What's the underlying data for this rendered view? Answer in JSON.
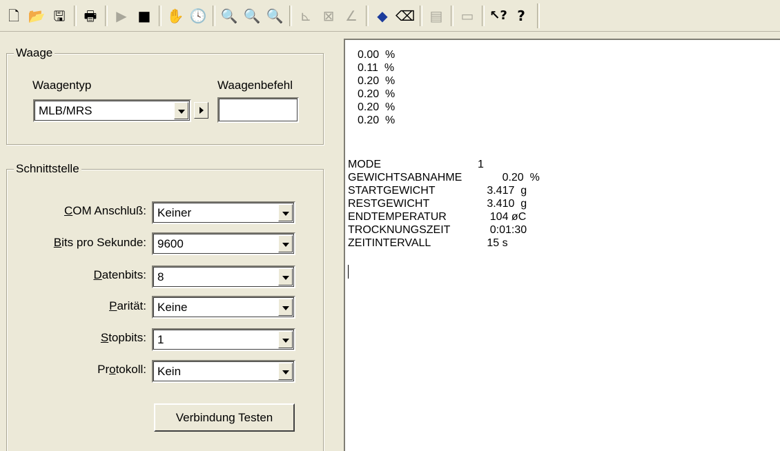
{
  "toolbar": {
    "buttons": [
      {
        "icon": "new-file-icon",
        "glyph": "🗋",
        "enabled": true
      },
      {
        "icon": "open-folder-icon",
        "glyph": "📂",
        "enabled": true
      },
      {
        "icon": "save-icon",
        "glyph": "🖫",
        "enabled": true
      },
      {
        "icon": "print-icon",
        "glyph": "🖶",
        "enabled": true
      },
      {
        "icon": "play-icon",
        "glyph": "▶",
        "enabled": false
      },
      {
        "icon": "stop-icon",
        "glyph": "■",
        "enabled": true
      },
      {
        "icon": "hand-icon",
        "glyph": "✋",
        "enabled": true
      },
      {
        "icon": "clock-icon",
        "glyph": "🕓",
        "enabled": true
      },
      {
        "icon": "zoom-in-icon",
        "glyph": "🔍",
        "enabled": false
      },
      {
        "icon": "zoom-out-icon",
        "glyph": "🔍",
        "enabled": false
      },
      {
        "icon": "zoom-fit-icon",
        "glyph": "🔍",
        "enabled": false
      },
      {
        "icon": "chart-line-icon",
        "glyph": "⊾",
        "enabled": false
      },
      {
        "icon": "chart-cross-icon",
        "glyph": "⊠",
        "enabled": false
      },
      {
        "icon": "chart-angle-icon",
        "glyph": "∠",
        "enabled": false
      },
      {
        "icon": "paint-bucket-icon",
        "glyph": "◆",
        "enabled": true
      },
      {
        "icon": "eraser-icon",
        "glyph": "⌫",
        "enabled": true
      },
      {
        "icon": "document-icon",
        "glyph": "▤",
        "enabled": false
      },
      {
        "icon": "window-icon",
        "glyph": "▭",
        "enabled": false
      },
      {
        "icon": "context-help-icon",
        "glyph": "↖?",
        "enabled": true
      },
      {
        "icon": "help-icon",
        "glyph": "?",
        "enabled": true
      }
    ]
  },
  "waage": {
    "title": "Waage",
    "waagentyp_label": "Waagentyp",
    "waagenbefehl_label": "Waagenbefehl",
    "waagentyp_value": "MLB/MRS",
    "waagenbefehl_value": ""
  },
  "schnittstelle": {
    "title": "Schnittstelle",
    "rows": [
      {
        "label_pre": "",
        "label_u": "C",
        "label_post": "OM Anschluß:",
        "value": "Keiner"
      },
      {
        "label_pre": "",
        "label_u": "B",
        "label_post": "its pro Sekunde:",
        "value": "9600"
      },
      {
        "label_pre": "",
        "label_u": "D",
        "label_post": "atenbits:",
        "value": "8"
      },
      {
        "label_pre": "",
        "label_u": "P",
        "label_post": "arität:",
        "value": "Keine"
      },
      {
        "label_pre": "",
        "label_u": "S",
        "label_post": "topbits:",
        "value": "1"
      },
      {
        "label_pre": "Pr",
        "label_u": "o",
        "label_post": "tokoll:",
        "value": "Kein"
      }
    ],
    "test_button": "Verbindung Testen"
  },
  "output": {
    "percent_lines": [
      "0.00  %",
      "0.11  %",
      "0.20  %",
      "0.20  %",
      "0.20  %",
      "0.20  %"
    ],
    "results": [
      {
        "key": "MODE",
        "value": "1"
      },
      {
        "key": "GEWICHTSABNAHME",
        "value": "        0.20  %"
      },
      {
        "key": "STARTGEWICHT",
        "value": "   3.417  g"
      },
      {
        "key": "RESTGEWICHT",
        "value": "   3.410  g"
      },
      {
        "key": "ENDTEMPERATUR",
        "value": "    104 øC"
      },
      {
        "key": "TROCKNUNGSZEIT",
        "value": "    0:01:30"
      },
      {
        "key": "ZEITINTERVALL",
        "value": "   15 s"
      }
    ]
  }
}
